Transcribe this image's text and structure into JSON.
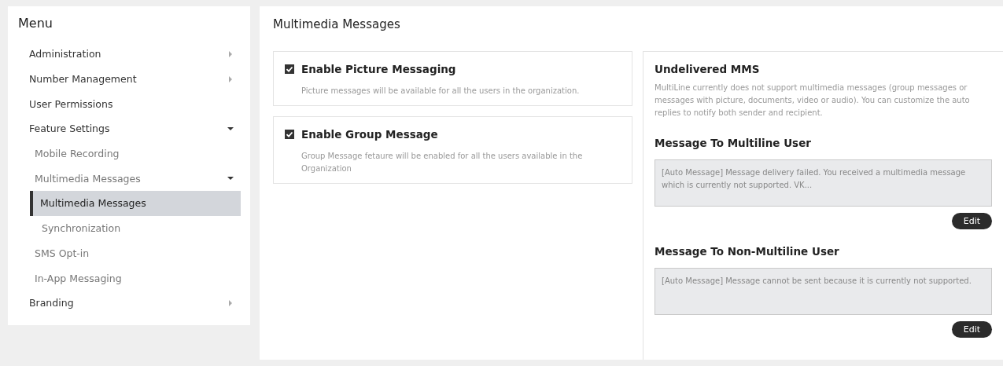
{
  "menu": {
    "title": "Menu",
    "items": [
      {
        "label": "Administration",
        "selected": false,
        "expanded": false
      },
      {
        "label": "Number Management",
        "selected": false,
        "expanded": false
      },
      {
        "label": "User Permissions",
        "selected": false
      },
      {
        "label": "Feature Settings",
        "selected": false,
        "expanded": true,
        "children": [
          {
            "label": "Mobile Recording",
            "selected": false
          },
          {
            "label": "Multimedia Messages",
            "selected": false,
            "expanded": true,
            "children": [
              {
                "label": "Multimedia Messages",
                "selected": true
              },
              {
                "label": "Synchronization",
                "selected": false
              }
            ]
          },
          {
            "label": "SMS Opt-in",
            "selected": false
          },
          {
            "label": "In-App Messaging",
            "selected": false
          }
        ]
      },
      {
        "label": "Branding",
        "selected": false,
        "expanded": false
      }
    ]
  },
  "page_title": "Multimedia Messages",
  "options": [
    {
      "label": "Enable Picture Messaging",
      "checked": true,
      "description": "Picture messages will be available for all the users in the organization."
    },
    {
      "label": "Enable Group Message",
      "checked": true,
      "description": "Group Message fetaure will be enabled for all the users available in the Organization"
    }
  ],
  "undelivered": {
    "title": "Undelivered MMS",
    "description": "MultiLine currently does not support multimedia messages (group messages or messages with picture, documents, video or audio). You can customize the auto replies to notify both sender and recipient.",
    "messages": [
      {
        "title": "Message To Multiline User",
        "value": "[Auto Message] Message delivery failed. You received a multimedia message which is currently not supported.  VK...",
        "button": "Edit"
      },
      {
        "title": "Message To Non-Multiline User",
        "value": "[Auto Message] Message cannot be sent because it is currently not supported.",
        "button": "Edit"
      }
    ]
  }
}
